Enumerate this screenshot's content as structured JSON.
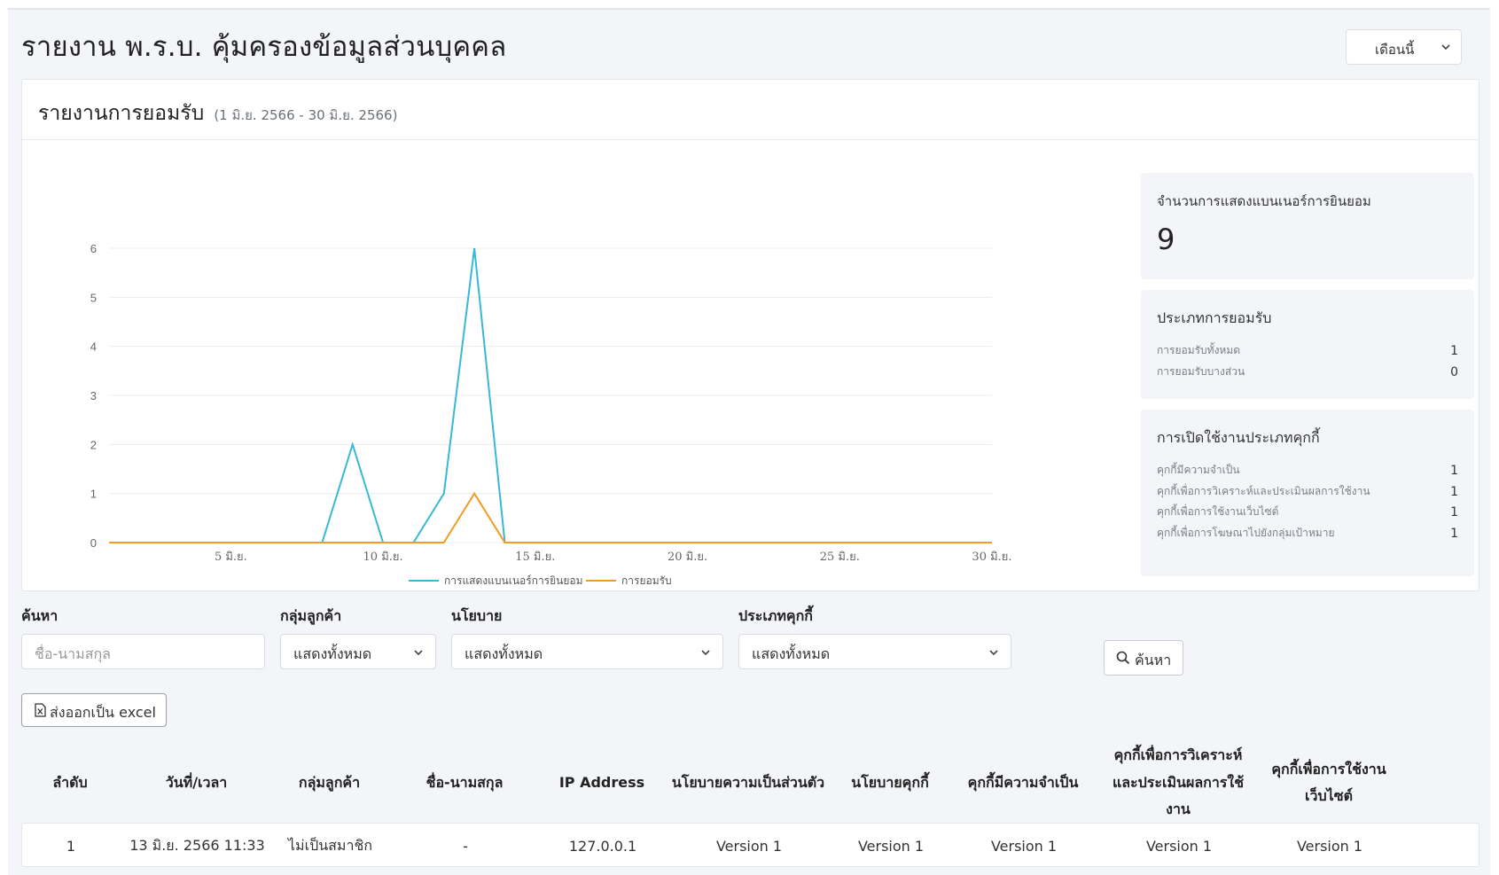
{
  "page": {
    "title": "รายงาน พ.ร.บ. คุ้มครองข้อมูลส่วนบุคคล",
    "period_select": "เดือนนี้"
  },
  "report": {
    "title": "รายงานการยอมรับ",
    "date_range": "(1 มิ.ย. 2566 - 30 มิ.ย. 2566)"
  },
  "chart_data": {
    "type": "line",
    "x": [
      1,
      2,
      3,
      4,
      5,
      6,
      7,
      8,
      9,
      10,
      11,
      12,
      13,
      14,
      15,
      16,
      17,
      18,
      19,
      20,
      21,
      22,
      23,
      24,
      25,
      26,
      27,
      28,
      29,
      30
    ],
    "x_tick_labels": [
      "5 มิ.ย.",
      "10 มิ.ย.",
      "15 มิ.ย.",
      "20 มิ.ย.",
      "25 มิ.ย.",
      "30 มิ.ย."
    ],
    "x_ticks": [
      5,
      10,
      15,
      20,
      25,
      30
    ],
    "ylim": [
      0,
      6
    ],
    "y_ticks": [
      0,
      1,
      2,
      3,
      4,
      5,
      6
    ],
    "grid": true,
    "legend_position": "bottom",
    "series": [
      {
        "name": "การแสดงแบนเนอร์การยินยอม",
        "color": "#36b9d6",
        "values": [
          0,
          0,
          0,
          0,
          0,
          0,
          0,
          0,
          2,
          0,
          0,
          1,
          6,
          0,
          0,
          0,
          0,
          0,
          0,
          0,
          0,
          0,
          0,
          0,
          0,
          0,
          0,
          0,
          0,
          0
        ]
      },
      {
        "name": "การยอมรับ",
        "color": "#f59a23",
        "values": [
          0,
          0,
          0,
          0,
          0,
          0,
          0,
          0,
          0,
          0,
          0,
          0,
          1,
          0,
          0,
          0,
          0,
          0,
          0,
          0,
          0,
          0,
          0,
          0,
          0,
          0,
          0,
          0,
          0,
          0
        ]
      }
    ]
  },
  "stats": {
    "banner_label": "จำนวนการแสดงแบนเนอร์การยินยอม",
    "banner_count": "9",
    "accept_type": {
      "title": "ประเภทการยอมรับ",
      "rows": [
        {
          "label": "การยอมรับทั้งหมด",
          "value": "1"
        },
        {
          "label": "การยอมรับบางส่วน",
          "value": "0"
        }
      ]
    },
    "cookie_type": {
      "title": "การเปิดใช้งานประเภทคุกกี้",
      "rows": [
        {
          "label": "คุกกี้มีความจำเป็น",
          "value": "1"
        },
        {
          "label": "คุกกี้เพื่อการวิเคราะห์และประเมินผลการใช้งาน",
          "value": "1"
        },
        {
          "label": "คุกกี้เพื่อการใช้งานเว็บไซต์",
          "value": "1"
        },
        {
          "label": "คุกกี้เพื่อการโฆษณาไปยังกลุ่มเป้าหมาย",
          "value": "1"
        }
      ]
    }
  },
  "filters": {
    "search_label": "ค้นหา",
    "search_placeholder": "ชื่อ-นามสกุล",
    "group_label": "กลุ่มลูกค้า",
    "group_value": "แสดงทั้งหมด",
    "policy_label": "นโยบาย",
    "policy_value": "แสดงทั้งหมด",
    "cookie_label": "ประเภทคุกกี้",
    "cookie_value": "แสดงทั้งหมด",
    "search_button": "ค้นหา",
    "export_button": "ส่งออกเป็น excel"
  },
  "table": {
    "columns": [
      "ลำดับ",
      "วันที่/เวลา",
      "กลุ่มลูกค้า",
      "ชื่อ-นามสกุล",
      "IP Address",
      "นโยบายความเป็นส่วนตัว",
      "นโยบายคุกกี้",
      "คุกกี้มีความจำเป็น",
      "คุกกี้เพื่อการวิเคราะห์และประเมินผลการใช้งาน",
      "คุกกี้เพื่อการใช้งานเว็บไซต์"
    ],
    "rows": [
      [
        "1",
        "13 มิ.ย. 2566 11:33",
        "ไม่เป็นสมาชิก",
        "-",
        "127.0.0.1",
        "Version 1",
        "Version 1",
        "Version 1",
        "Version 1",
        "Version 1"
      ]
    ]
  }
}
